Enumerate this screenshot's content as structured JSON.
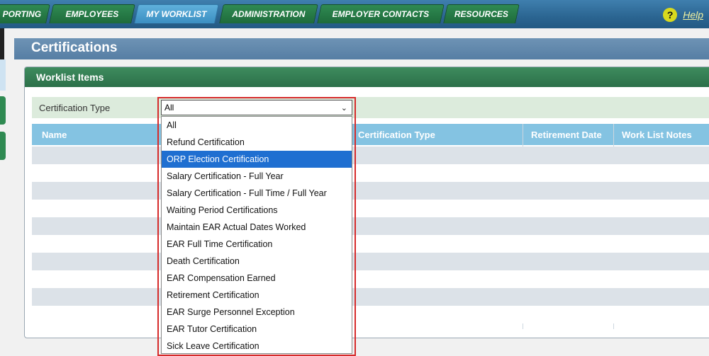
{
  "nav": {
    "tabs": [
      {
        "label": "PORTING"
      },
      {
        "label": "EMPLOYEES"
      },
      {
        "label": "MY WORKLIST"
      },
      {
        "label": "ADMINISTRATION"
      },
      {
        "label": "EMPLOYER CONTACTS"
      },
      {
        "label": "RESOURCES"
      }
    ],
    "active_tab": "MY WORKLIST",
    "help_icon": "?",
    "help_label": "Help"
  },
  "page": {
    "title": "Certifications"
  },
  "panel": {
    "title": "Worklist Items",
    "filter_label": "Certification Type",
    "select_value": "All",
    "columns": [
      "Name",
      "Certification Type",
      "Retirement Date",
      "Work List Notes"
    ]
  },
  "dropdown": {
    "options": [
      "All",
      "Refund Certification",
      "ORP Election Certification",
      "Salary Certification - Full Year",
      "Salary Certification - Full Time / Full Year",
      "Waiting Period Certifications",
      "Maintain EAR Actual Dates Worked",
      "EAR Full Time Certification",
      "Death Certification",
      "EAR Compensation Earned",
      "Retirement Certification",
      "EAR Surge Personnel Exception",
      "EAR Tutor Certification",
      "Sick Leave Certification"
    ],
    "highlighted": "ORP Election Certification"
  },
  "colors": {
    "nav_bg": "#2b6591",
    "tab_green": "#2f8a52",
    "tab_active": "#4aa0d0",
    "panel_head": "#2c7049",
    "table_head": "#84c3e2",
    "highlight": "#1f6fd1",
    "annotation_border": "#d62b2b"
  }
}
